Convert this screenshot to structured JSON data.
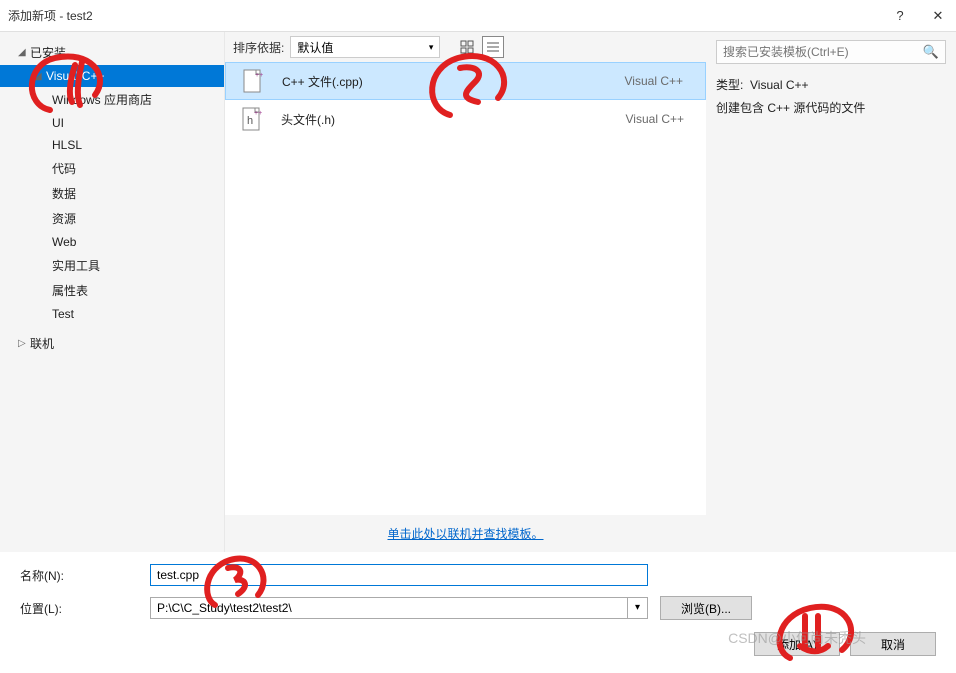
{
  "titlebar": {
    "title": "添加新项 - test2",
    "help": "?",
    "close": "✕"
  },
  "sidebar": {
    "installed": "已安装",
    "visual_cpp": "Visual C++",
    "items": [
      "Windows 应用商店",
      "UI",
      "HLSL",
      "代码",
      "数据",
      "资源",
      "Web",
      "实用工具",
      "属性表",
      "Test"
    ],
    "online": "联机"
  },
  "sort": {
    "label": "排序依据:",
    "value": "默认值"
  },
  "list": [
    {
      "name": "C++ 文件(.cpp)",
      "lang": "Visual C++",
      "selected": true
    },
    {
      "name": "头文件(.h)",
      "lang": "Visual C++",
      "selected": false
    }
  ],
  "online_link": "单击此处以联机并查找模板。",
  "search": {
    "placeholder": "搜索已安装模板(Ctrl+E)"
  },
  "details": {
    "type_label": "类型:",
    "type_value": "Visual C++",
    "description": "创建包含 C++ 源代码的文件"
  },
  "form": {
    "name_label": "名称(N):",
    "name_value": "test.cpp",
    "location_label": "位置(L):",
    "location_value": "P:\\C\\C_Study\\test2\\test2\\",
    "browse": "浏览(B)..."
  },
  "buttons": {
    "add": "添加(A)",
    "cancel": "取消"
  },
  "watermark": "CSDN@小何尚未秃头"
}
